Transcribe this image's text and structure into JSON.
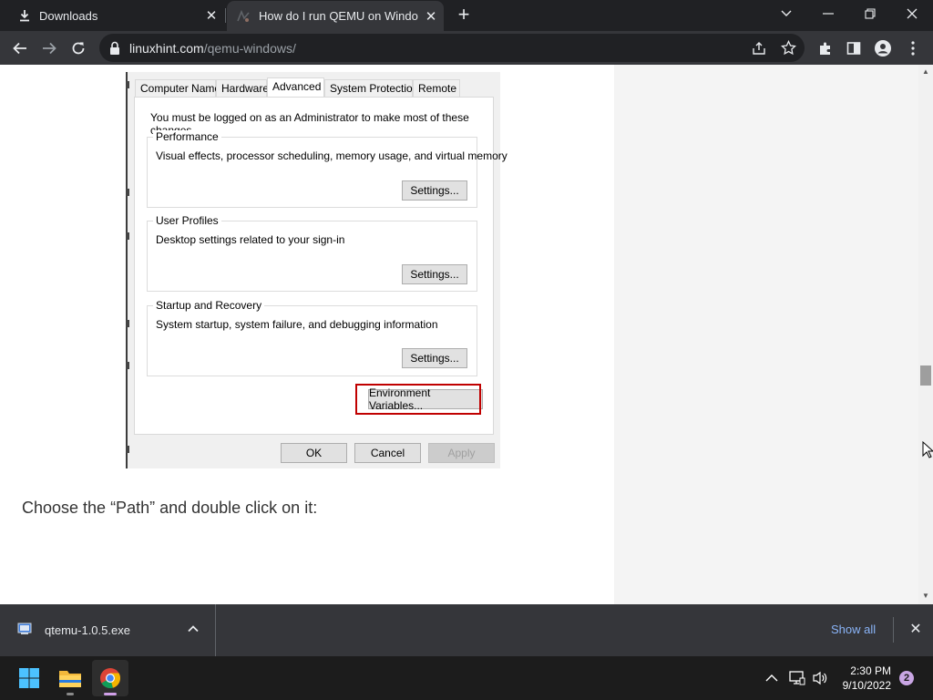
{
  "browser": {
    "tabs": [
      {
        "label": "Downloads",
        "icon": "download-icon",
        "active": false
      },
      {
        "label": "How do I run QEMU on Windows",
        "icon": "site-favicon",
        "active": true
      }
    ],
    "address": {
      "domain": "linuxhint.com",
      "path": "/qemu-windows/"
    }
  },
  "dialog": {
    "tabs": [
      "Computer Name",
      "Hardware",
      "Advanced",
      "System Protection",
      "Remote"
    ],
    "selected_tab": "Advanced",
    "notice": "You must be logged on as an Administrator to make most of these changes.",
    "groups": [
      {
        "title": "Performance",
        "description": "Visual effects, processor scheduling, memory usage, and virtual memory",
        "button": "Settings..."
      },
      {
        "title": "User Profiles",
        "description": "Desktop settings related to your sign-in",
        "button": "Settings..."
      },
      {
        "title": "Startup and Recovery",
        "description": "System startup, system failure, and debugging information",
        "button": "Settings..."
      }
    ],
    "env_button": "Environment Variables...",
    "ok": "OK",
    "cancel": "Cancel",
    "apply": "Apply"
  },
  "article": {
    "caption": "Choose the “Path” and double click on it:"
  },
  "downloads_shelf": {
    "file": "qtemu-1.0.5.exe",
    "show_all": "Show all"
  },
  "taskbar": {
    "time": "2:30 PM",
    "date": "9/10/2022",
    "notification_count": "2"
  },
  "colors": {
    "highlight_border": "#c00000",
    "link_blue": "#8ab4f8",
    "chrome_dark": "#202124"
  }
}
